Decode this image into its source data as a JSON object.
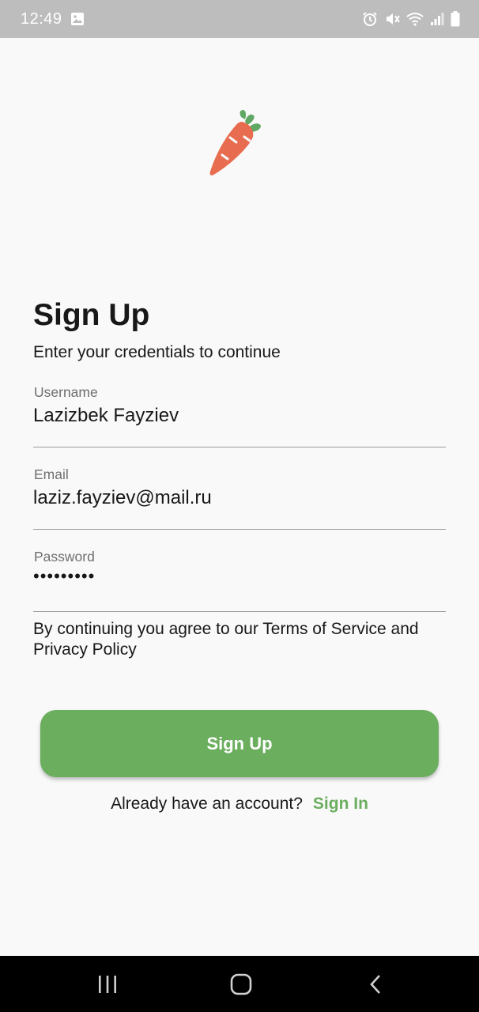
{
  "status_bar": {
    "time": "12:49",
    "icons": [
      "image-icon",
      "alarm-icon",
      "mute-icon",
      "wifi-icon",
      "signal-icon",
      "battery-icon"
    ]
  },
  "logo": {
    "icon": "carrot-icon"
  },
  "page": {
    "title": "Sign Up",
    "subtitle": "Enter your credentials to continue"
  },
  "form": {
    "username": {
      "label": "Username",
      "value": "Lazizbek Fayziev"
    },
    "email": {
      "label": "Email",
      "value": "laziz.fayziev@mail.ru"
    },
    "password": {
      "label": "Password",
      "value": "•••••••••"
    }
  },
  "terms_text": "By continuing you agree to our Terms of Service and Privacy Policy",
  "signup_button_label": "Sign Up",
  "signin": {
    "prompt": "Already have an account?",
    "link_label": "Sign In"
  },
  "nav_bar": {
    "icons": [
      "recent-apps-icon",
      "home-icon",
      "back-icon"
    ]
  },
  "colors": {
    "accent": "#6aae5e",
    "carrot": "#e86c4f",
    "leaf": "#5fa863",
    "status_bar": "#bdbdbd",
    "background": "#f9f9f9"
  }
}
